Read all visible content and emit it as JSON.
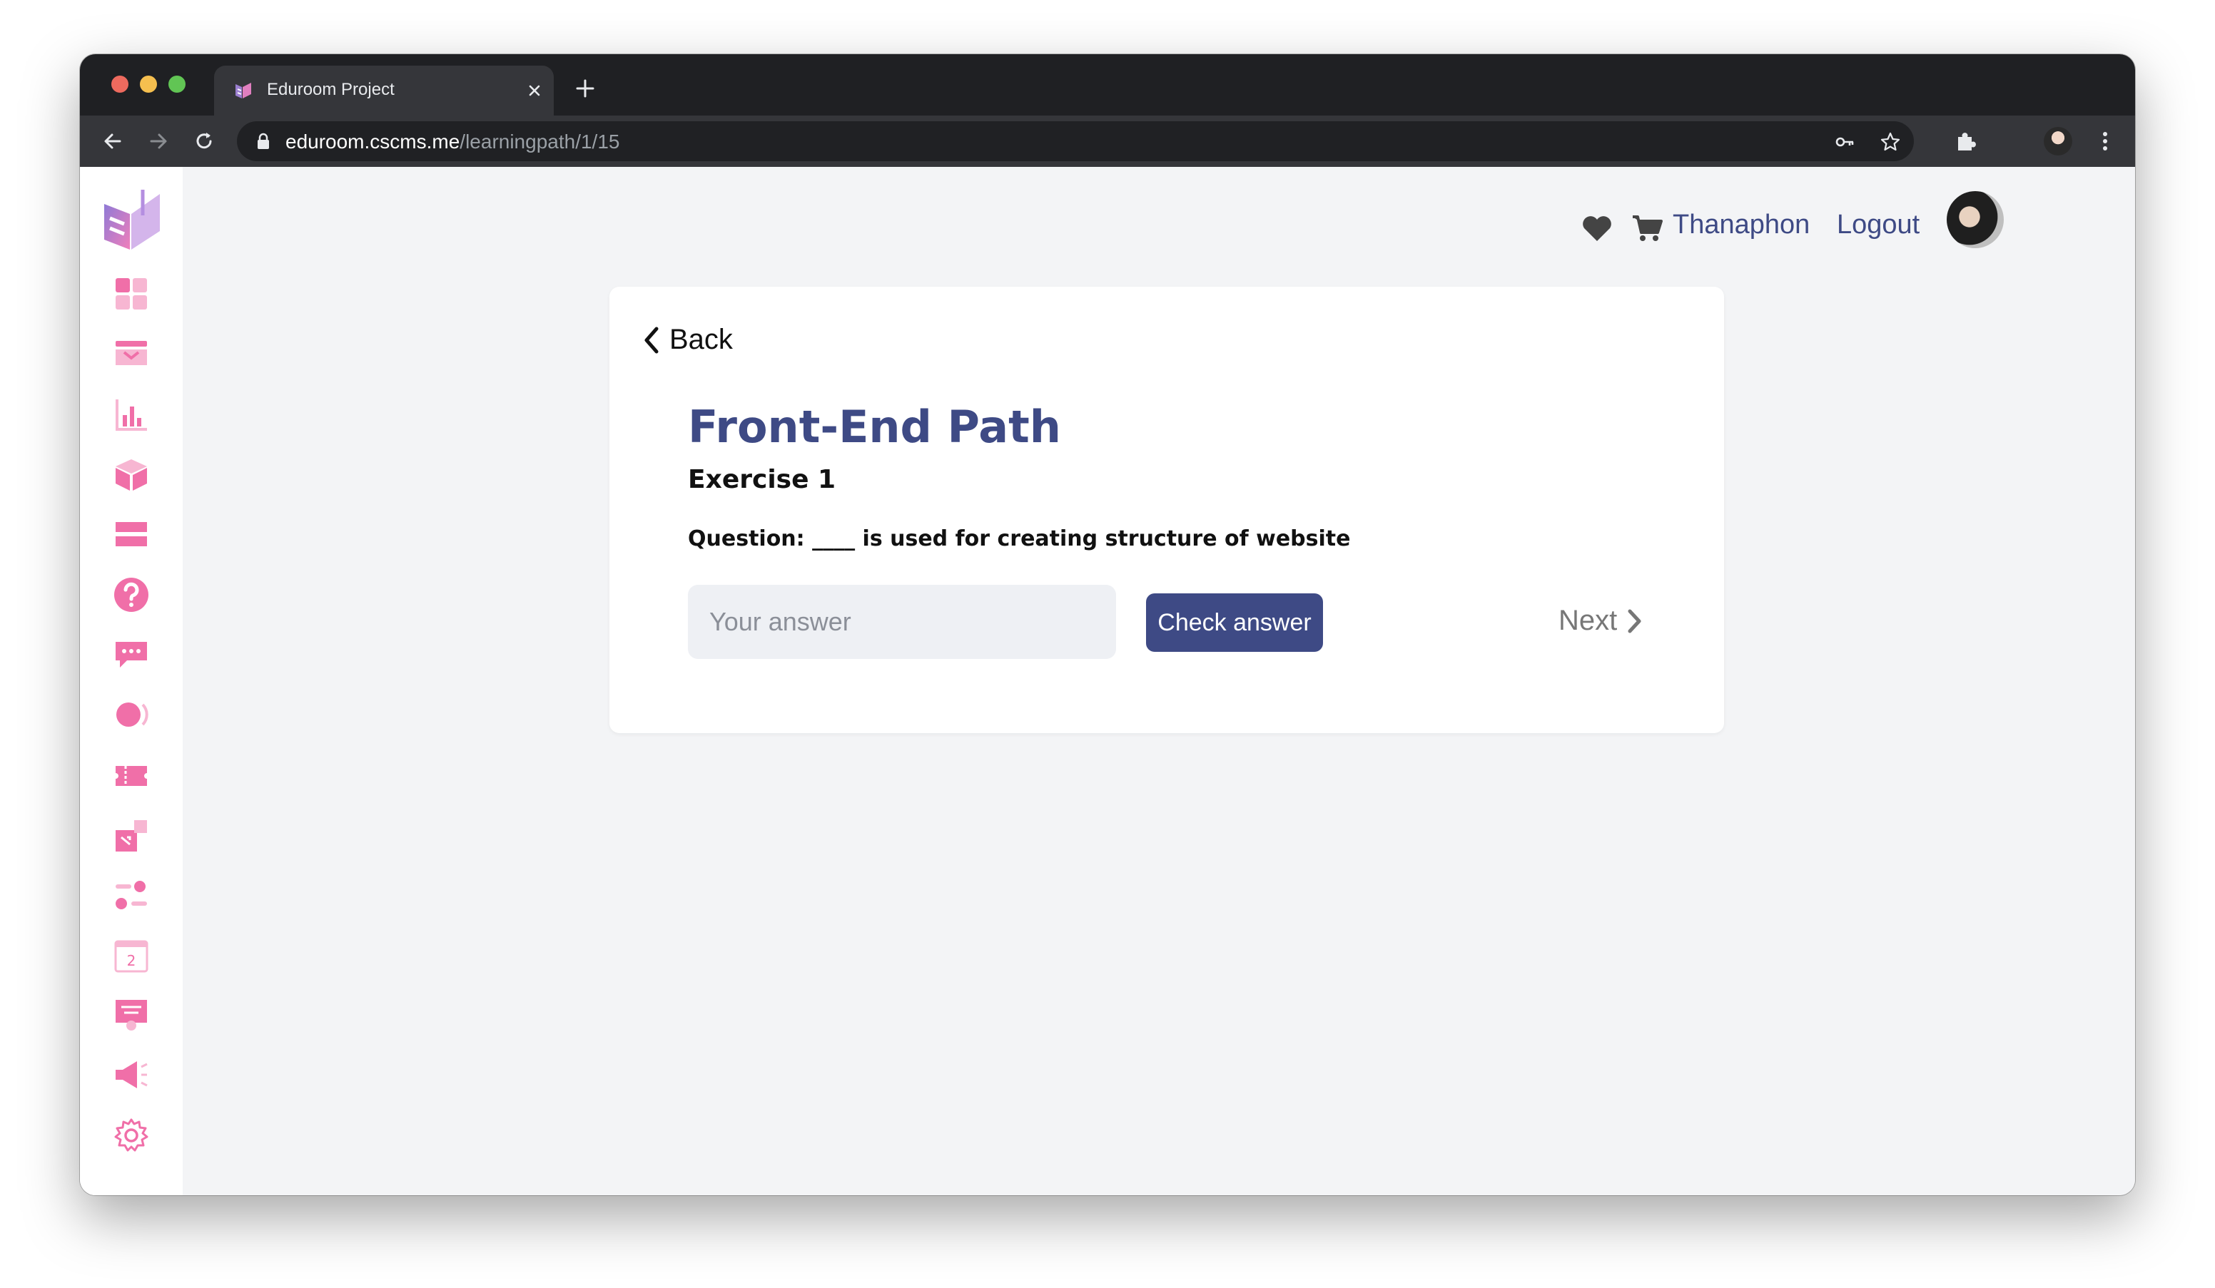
{
  "browser": {
    "tab_title": "Eduroom Project",
    "url_host": "eduroom.cscms.me",
    "url_path": "/learningpath/1/15"
  },
  "header": {
    "username": "Thanaphon",
    "logout_label": "Logout"
  },
  "sidebar": {
    "items": [
      {
        "icon": "dashboard-icon"
      },
      {
        "icon": "inbox-icon"
      },
      {
        "icon": "chart-icon"
      },
      {
        "icon": "box-icon"
      },
      {
        "icon": "card-icon"
      },
      {
        "icon": "help-icon"
      },
      {
        "icon": "chat-icon"
      },
      {
        "icon": "podcast-icon"
      },
      {
        "icon": "ticket-icon"
      },
      {
        "icon": "puzzle-icon"
      },
      {
        "icon": "toggle-icon"
      },
      {
        "icon": "calendar-icon"
      },
      {
        "icon": "certificate-icon"
      },
      {
        "icon": "megaphone-icon"
      },
      {
        "icon": "settings-icon"
      }
    ],
    "calendar_day": "2"
  },
  "exercise": {
    "back_label": "Back",
    "path_title": "Front-End Path",
    "exercise_label": "Exercise 1",
    "question": "Question: ____ is used for creating structure of website",
    "answer_placeholder": "Your answer",
    "answer_value": "",
    "check_label": "Check answer",
    "next_label": "Next"
  },
  "colors": {
    "primary": "#3e4a85",
    "sidebar_icon": "#f06fa8",
    "background": "#f3f4f6"
  }
}
